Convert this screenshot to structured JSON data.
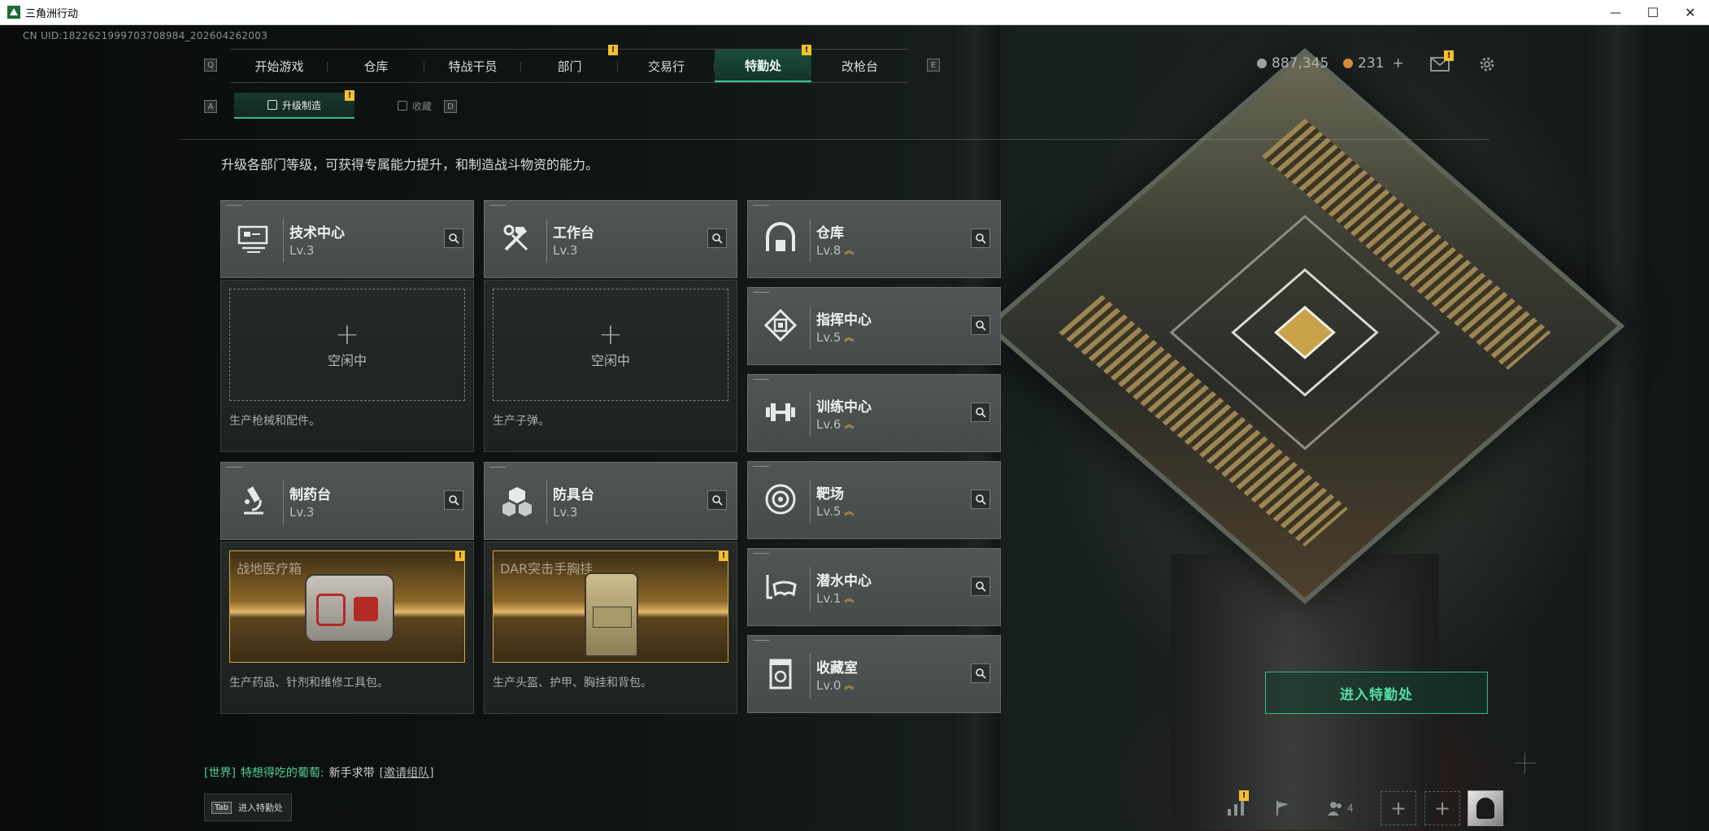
{
  "window": {
    "title": "三角洲行动",
    "controls": {
      "minimize": "—",
      "maximize": "☐",
      "close": "✕"
    }
  },
  "uid": "CN UID:1822621999703708984_202604262003",
  "topnav": {
    "left_key": "Q",
    "right_key": "E",
    "tabs": [
      {
        "label": "开始游戏",
        "active": false,
        "badge": ""
      },
      {
        "label": "仓库",
        "active": false,
        "badge": ""
      },
      {
        "label": "特战干员",
        "active": false,
        "badge": ""
      },
      {
        "label": "部门",
        "active": false,
        "badge": "!"
      },
      {
        "label": "交易行",
        "active": false,
        "badge": ""
      },
      {
        "label": "特勤处",
        "active": true,
        "badge": "!"
      },
      {
        "label": "改枪台",
        "active": false,
        "badge": ""
      }
    ]
  },
  "subnav": {
    "left_key": "A",
    "right_key": "D",
    "tabs": [
      {
        "label": "升级制造",
        "active": true,
        "badge": "!"
      },
      {
        "label": "收藏",
        "active": false
      }
    ]
  },
  "hud": {
    "currency1": "887,345",
    "currency2": "231",
    "currency2_add": "+",
    "mail_badge": "!",
    "colors": {
      "accent": "#35c88f",
      "badge": "#f2c02f",
      "coin1": "#9aa3a0",
      "coin2": "#d18b3a"
    }
  },
  "description": "升级各部门等级，可获得专属能力提升，和制造战斗物资的能力。",
  "stations": {
    "tech_center": {
      "name": "技术中心",
      "level": "Lv.3",
      "icon": "computer-icon"
    },
    "workbench": {
      "name": "工作台",
      "level": "Lv.3",
      "icon": "tools-icon"
    },
    "pharmacy": {
      "name": "制药台",
      "level": "Lv.3",
      "icon": "microscope-icon"
    },
    "armor_bench": {
      "name": "防具台",
      "level": "Lv.3",
      "icon": "cubes-icon"
    },
    "warehouse": {
      "name": "仓库",
      "level": "Lv.8",
      "icon": "vault-icon"
    },
    "command": {
      "name": "指挥中心",
      "level": "Lv.5",
      "icon": "chip-icon"
    },
    "training": {
      "name": "训练中心",
      "level": "Lv.6",
      "icon": "dumbbell-icon"
    },
    "range": {
      "name": "靶场",
      "level": "Lv.5",
      "icon": "target-icon"
    },
    "diving": {
      "name": "潜水中心",
      "level": "Lv.1",
      "icon": "diving-mask-icon"
    },
    "collection": {
      "name": "收藏室",
      "level": "Lv.0",
      "icon": "collection-icon"
    }
  },
  "production": {
    "tech": {
      "status": "空闲中",
      "plus": "+",
      "caption": "生产枪械和配件。"
    },
    "workbench": {
      "status": "空闲中",
      "plus": "+",
      "caption": "生产子弹。"
    },
    "pharmacy": {
      "product": "战地医疗箱",
      "caption": "生产药品、针剂和维修工具包。",
      "badge": "!"
    },
    "armor": {
      "product": "DAR突击手胸挂",
      "caption": "生产头盔、护甲、胸挂和背包。",
      "badge": "!"
    }
  },
  "enter_button": "进入特勤处",
  "chat": {
    "channel": "[世界]",
    "sender": "特想得吃的葡萄:",
    "message": "新手求带",
    "link": "[邀请组队]"
  },
  "tab_hint": {
    "key": "Tab",
    "label": "进入特勤处"
  },
  "bottom_bar": {
    "stats_badge": "!",
    "friends_count": "4",
    "slot_plus": "+"
  }
}
